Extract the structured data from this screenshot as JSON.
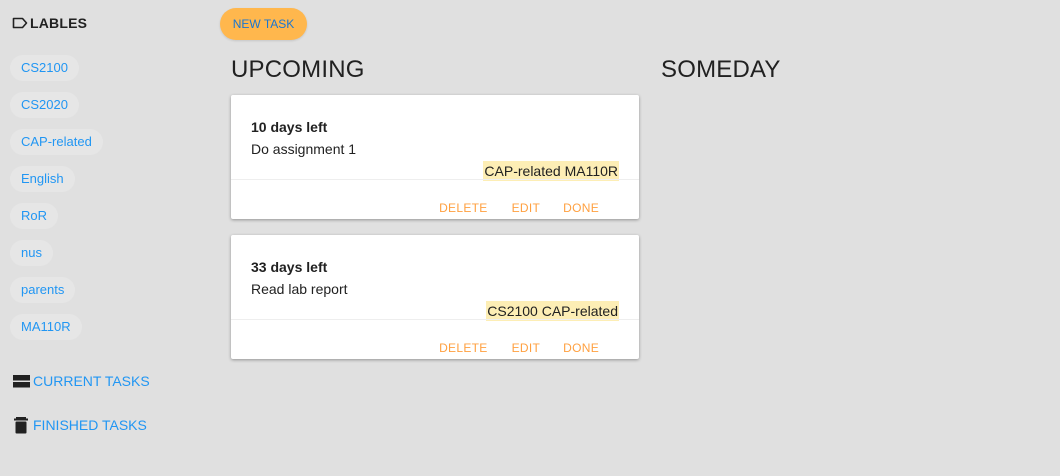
{
  "sidebar": {
    "labels_title": "LABLES",
    "labels": [
      "CS2100",
      "CS2020",
      "CAP-related",
      "English",
      "RoR",
      "nus",
      "parents",
      "MA110R"
    ],
    "nav": {
      "current_tasks": "CURRENT TASKS",
      "finished_tasks": "FINISHED TASKS"
    }
  },
  "toolbar": {
    "new_task_label": "NEW TASK"
  },
  "columns": {
    "upcoming_title": "UPCOMING",
    "someday_title": "SOMEDAY"
  },
  "tasks": [
    {
      "due": "10 days left",
      "description": "Do assignment 1",
      "tags": "CAP-related MA110R"
    },
    {
      "due": "33 days left",
      "description": "Read lab report",
      "tags": "CS2100 CAP-related"
    }
  ],
  "card_actions": {
    "delete": "DELETE",
    "edit": "EDIT",
    "done": "DONE"
  },
  "colors": {
    "background": "#e0e0e0",
    "link_blue": "#2196f3",
    "accent_orange": "#ffb74d",
    "action_orange": "#ffa040",
    "tag_highlight": "#fdeeb5"
  },
  "icons": {
    "labels": "label-outline-icon",
    "current_tasks": "view-agenda-icon",
    "finished_tasks": "trash-icon"
  }
}
